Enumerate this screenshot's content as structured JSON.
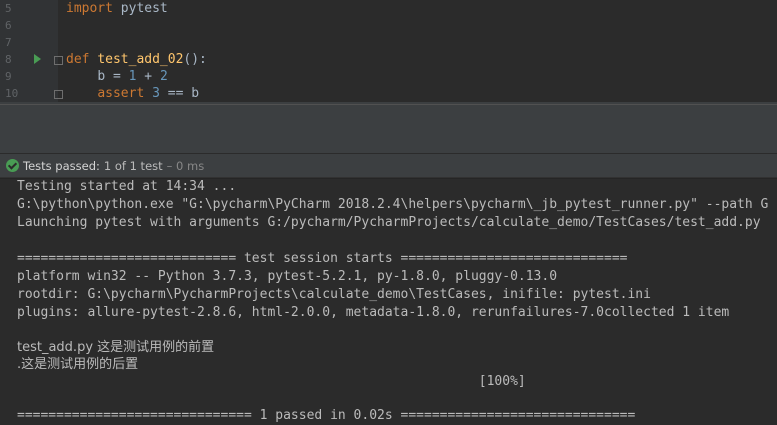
{
  "editor": {
    "lines": [
      {
        "num": "5",
        "kw": "import",
        "rest": " pytest"
      },
      {
        "num": "6"
      },
      {
        "num": "7"
      },
      {
        "num": "8",
        "kw": "def",
        "space": " ",
        "fn": "test_add_02",
        "rest": "():"
      },
      {
        "num": "9",
        "indent": "    ",
        "var": "b",
        "eq": " = ",
        "n1": "1",
        "plus": " + ",
        "n2": "2"
      },
      {
        "num": "10",
        "indent": "    ",
        "kw": "assert",
        "sp": " ",
        "n1": "3",
        "rest": " == b"
      }
    ]
  },
  "run_panel": {
    "status_label": "Tests passed:",
    "status_count": "1 of 1 test",
    "status_extra": "– 0 ms"
  },
  "console": {
    "lines": [
      "Testing started at 14:34 ...",
      "G:\\python\\python.exe \"G:\\pycharm\\PyCharm 2018.2.4\\helpers\\pycharm\\_jb_pytest_runner.py\" --path G",
      "Launching pytest with arguments G:/pycharm/PycharmProjects/calculate_demo/TestCases/test_add.py",
      "",
      "============================ test session starts =============================",
      "platform win32 -- Python 3.7.3, pytest-5.2.1, py-1.8.0, pluggy-0.13.0",
      "rootdir: G:\\pycharm\\PycharmProjects\\calculate_demo\\TestCases, inifile: pytest.ini",
      "plugins: allure-pytest-2.8.6, html-2.0.0, metadata-1.8.0, rerunfailures-7.0collected 1 item",
      "",
      "test_add.py 这是测试用例的前置",
      ".这是测试用例的后置",
      "                                                           [100%]",
      "",
      "============================== 1 passed in 0.02s =============================="
    ]
  },
  "colors": {
    "background": "#2b2b2b",
    "keyword": "#cc7832",
    "function": "#ffc66d",
    "number": "#6897bb",
    "pass_green": "#499c54"
  }
}
